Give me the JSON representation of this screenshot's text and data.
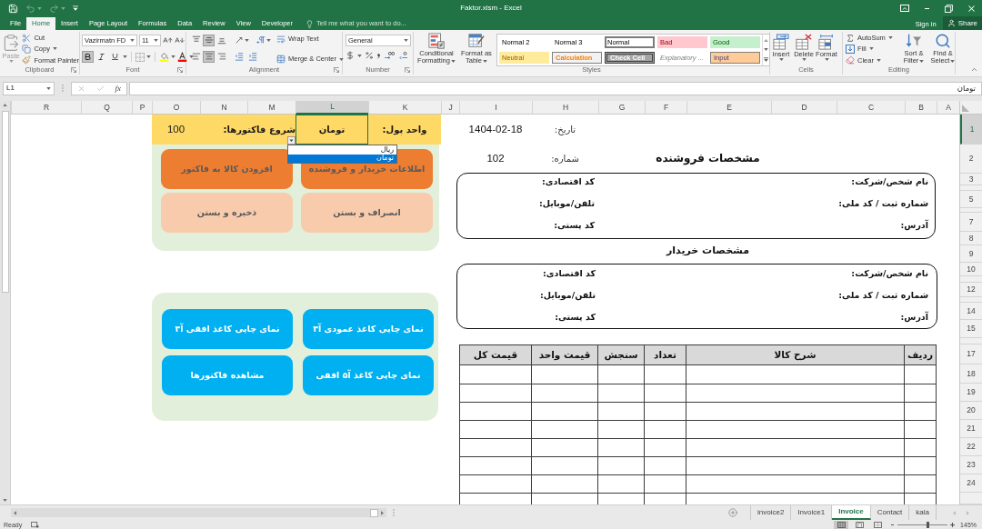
{
  "window": {
    "title": "Faktor.xlsm - Excel"
  },
  "quick_access": [
    {
      "kind": "save",
      "disabled": false
    },
    {
      "kind": "undo",
      "disabled": true
    },
    {
      "kind": "redo",
      "disabled": true
    }
  ],
  "ribbon_tabs": [
    {
      "label": "Developer",
      "selected": false
    },
    {
      "label": "View",
      "selected": false
    },
    {
      "label": "Review",
      "selected": false
    },
    {
      "label": "Data",
      "selected": false
    },
    {
      "label": "Formulas",
      "selected": false
    },
    {
      "label": "Page Layout",
      "selected": false
    },
    {
      "label": "Insert",
      "selected": false
    },
    {
      "label": "Home",
      "selected": true
    },
    {
      "label": "File",
      "selected": false
    }
  ],
  "tell_me": {
    "placeholder": "Tell me what you want to do..."
  },
  "account": {
    "sign_in": "Sign in",
    "share": "Share"
  },
  "ribbon": {
    "clipboard": {
      "label": "Clipboard",
      "paste": {
        "label": "Paste",
        "disabled": true
      },
      "cut": "Cut",
      "copy": "Copy",
      "format_painter": "Format Painter"
    },
    "font": {
      "label": "Font",
      "font_name": "Vazirmatn FD",
      "font_size": "11",
      "bold": true,
      "italic": false,
      "underline": false
    },
    "alignment": {
      "label": "Alignment",
      "vertical": [
        {
          "kind": "top",
          "selected": false
        },
        {
          "kind": "middle",
          "selected": true
        },
        {
          "kind": "bottom",
          "selected": false
        }
      ],
      "horizontal": [
        {
          "kind": "left",
          "selected": false
        },
        {
          "kind": "center",
          "selected": true
        },
        {
          "kind": "right",
          "selected": false
        }
      ],
      "wrap_text": "Wrap Text",
      "merge_center": "Merge & Center"
    },
    "number": {
      "label": "Number",
      "format": "General"
    },
    "styles": {
      "label": "Styles",
      "conditional_formatting": "Conditional Formatting",
      "format_as_table": "Format as Table",
      "gallery": [
        {
          "label": "Good",
          "kind": "good",
          "selected": false
        },
        {
          "label": "Bad",
          "kind": "bad",
          "selected": false
        },
        {
          "label": "Normal",
          "kind": "plain",
          "selected": true
        },
        {
          "label": "Normal 3",
          "kind": "plain",
          "selected": false
        },
        {
          "label": "Normal 2",
          "kind": "plain",
          "selected": false
        },
        {
          "label": "Input",
          "kind": "input",
          "selected": false
        },
        {
          "label": "Explanatory ...",
          "kind": "explanatory",
          "selected": false
        },
        {
          "label": "Check Cell",
          "kind": "check",
          "selected": false
        },
        {
          "label": "Calculation",
          "kind": "calculation",
          "selected": false
        },
        {
          "label": "Neutral",
          "kind": "neutral",
          "selected": false
        }
      ]
    },
    "cells": {
      "label": "Cells",
      "buttons": [
        {
          "label": "Format",
          "kind": "format"
        },
        {
          "label": "Delete",
          "kind": "delete"
        },
        {
          "label": "Insert",
          "kind": "insert"
        }
      ]
    },
    "editing": {
      "label": "Editing",
      "autosum": "AutoSum",
      "fill": "Fill",
      "clear": "Clear",
      "sort_filter": "Sort & Filter",
      "find_select": "Find & Select"
    }
  },
  "formula_bar": {
    "name_box": "L1",
    "insert_function": "fx",
    "value": "تومان"
  },
  "columns": [
    {
      "label": "A",
      "selected": false
    },
    {
      "label": "B",
      "selected": false
    },
    {
      "label": "C",
      "selected": false
    },
    {
      "label": "D",
      "selected": false
    },
    {
      "label": "E",
      "selected": false
    },
    {
      "label": "F",
      "selected": false
    },
    {
      "label": "G",
      "selected": false
    },
    {
      "label": "H",
      "selected": false
    },
    {
      "label": "I",
      "selected": false
    },
    {
      "label": "J",
      "selected": false
    },
    {
      "label": "K",
      "selected": false
    },
    {
      "label": "L",
      "selected": true
    },
    {
      "label": "M",
      "selected": false
    },
    {
      "label": "N",
      "selected": false
    },
    {
      "label": "O",
      "selected": false
    },
    {
      "label": "P",
      "selected": false
    },
    {
      "label": "Q",
      "selected": false
    },
    {
      "label": "R",
      "selected": false
    }
  ],
  "rows": [
    {
      "label": "1",
      "selected": true
    },
    {
      "label": "2",
      "selected": false
    },
    {
      "label": "3",
      "selected": false
    },
    {
      "label": "5",
      "selected": false
    },
    {
      "label": "7",
      "selected": false
    },
    {
      "label": "8",
      "selected": false
    },
    {
      "label": "9",
      "selected": false
    },
    {
      "label": "10",
      "selected": false
    },
    {
      "label": "12",
      "selected": false
    },
    {
      "label": "14",
      "selected": false
    },
    {
      "label": "15",
      "selected": false
    },
    {
      "label": "17",
      "selected": false
    },
    {
      "label": "18",
      "selected": false
    },
    {
      "label": "19",
      "selected": false
    },
    {
      "label": "20",
      "selected": false
    },
    {
      "label": "21",
      "selected": false
    },
    {
      "label": "22",
      "selected": false
    },
    {
      "label": "23",
      "selected": false
    },
    {
      "label": "24",
      "selected": false
    }
  ],
  "sheet": {
    "currency": {
      "label": "واحد پول:",
      "value": "تومان",
      "selected": true,
      "options": [
        {
          "label": "ریال",
          "selected": false
        },
        {
          "label": "تومان",
          "selected": true
        }
      ]
    },
    "start_number": {
      "label": "شروع فاکتورها:",
      "value": "100"
    },
    "date": {
      "label": "تاریخ:",
      "value": "1404-02-18"
    },
    "invoice_number": {
      "label": "شماره:",
      "value": "102"
    },
    "seller": {
      "title": "مشخصات فروشنده",
      "fields": [
        "نام شخص/شرکت:",
        "کد اقتصادی:",
        "شماره ثبت / کد ملی:",
        "تلفن/موبایل:",
        "آدرس:",
        "کد پستی:"
      ]
    },
    "buyer": {
      "title": "مشخصات خریدار",
      "fields": [
        "نام شخص/شرکت:",
        "کد اقتصادی:",
        "شماره ثبت / کد ملی:",
        "تلفن/موبایل:",
        "آدرس:",
        "کد پستی:"
      ]
    },
    "items_table": {
      "columns": [
        "ردیف",
        "شرح کالا",
        "تعداد",
        "سنجش",
        "قیمت واحد",
        "قیمت کل"
      ]
    },
    "control_panel": {
      "buttons": [
        {
          "label": "اطلاعات خریدار و فروشنده",
          "color": "#ed7d31"
        },
        {
          "label": "افزودن کالا به فاکتور",
          "color": "#ed7d31"
        },
        {
          "label": "انصراف و بستن",
          "color": "#f8cbad"
        },
        {
          "label": "ذخیره و بستن",
          "color": "#f8cbad"
        }
      ]
    },
    "print_panel": {
      "buttons": [
        "نمای چاپی کاغذ عمودی آ۴",
        "نمای چاپی کاغذ افقی آ۴",
        "نمای چاپی کاغذ آ۵ افقی",
        "مشاهده فاکتورها"
      ]
    }
  },
  "sheet_tabs": [
    {
      "label": "kala",
      "selected": false
    },
    {
      "label": "Contact",
      "selected": false
    },
    {
      "label": "Invoice",
      "selected": true
    },
    {
      "label": "Invoice1",
      "selected": false
    },
    {
      "label": "invoice2",
      "selected": false
    }
  ],
  "status_bar": {
    "status": "Ready",
    "views": [
      {
        "kind": "normal",
        "selected": true
      },
      {
        "kind": "page_layout",
        "selected": false
      },
      {
        "kind": "page_break",
        "selected": false
      }
    ],
    "zoom": {
      "level": 0.6,
      "label": "145%"
    }
  }
}
